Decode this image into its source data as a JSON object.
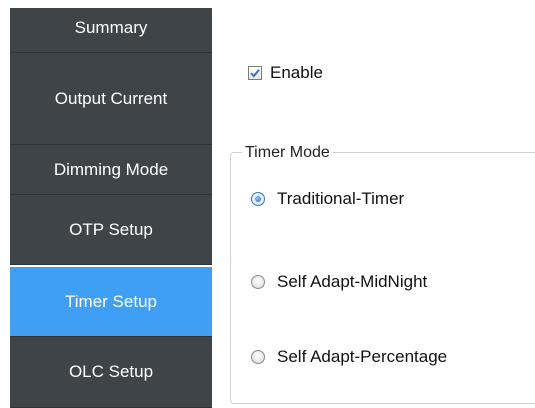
{
  "sidebar": {
    "items": [
      {
        "label": "Summary",
        "active": false
      },
      {
        "label": "Output Current",
        "active": false
      },
      {
        "label": "Dimming Mode",
        "active": false
      },
      {
        "label": "OTP Setup",
        "active": false
      },
      {
        "label": "Timer Setup",
        "active": true
      },
      {
        "label": "OLC Setup",
        "active": false
      }
    ]
  },
  "enable": {
    "label": "Enable",
    "checked": true
  },
  "timer_mode": {
    "title": "Timer Mode",
    "options": [
      {
        "label": "Traditional-Timer",
        "selected": true
      },
      {
        "label": "Self Adapt-MidNight",
        "selected": false
      },
      {
        "label": "Self Adapt-Percentage",
        "selected": false
      }
    ]
  },
  "colors": {
    "sidebar_bg": "#3f4448",
    "sidebar_active_bg": "#3f9ff5",
    "sidebar_text": "#ffffff",
    "check_color": "#3a6fc0"
  }
}
